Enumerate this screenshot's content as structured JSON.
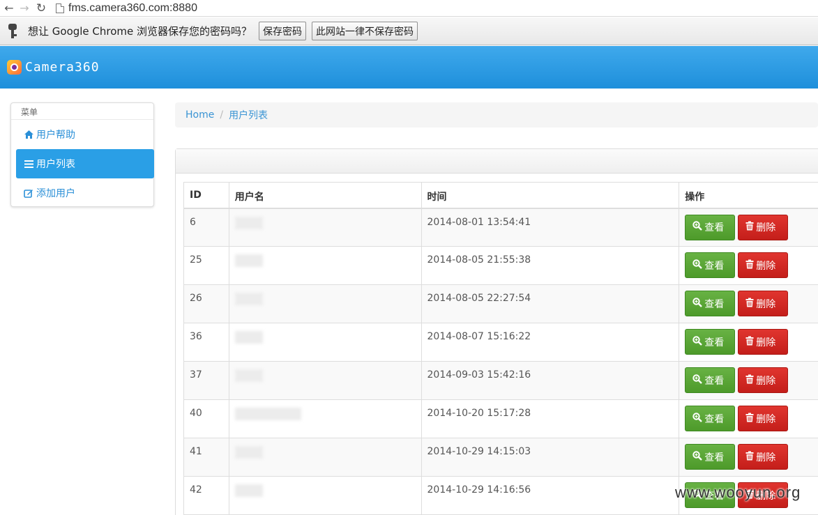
{
  "browser": {
    "url": "fms.camera360.com:8880",
    "back_icon": "arrow-left-icon",
    "forward_icon": "arrow-right-icon",
    "reload_icon": "reload-icon"
  },
  "infobar": {
    "message": "想让 Google Chrome 浏览器保存您的密码吗？",
    "save_label": "保存密码",
    "never_label": "此网站一律不保存密码"
  },
  "header": {
    "brand": "Camera360"
  },
  "sidebar": {
    "title": "菜单",
    "items": [
      {
        "label": "用户帮助",
        "icon": "home-icon"
      },
      {
        "label": "用户列表",
        "icon": "list-icon",
        "active": true
      },
      {
        "label": "添加用户",
        "icon": "edit-icon"
      }
    ]
  },
  "breadcrumb": {
    "home": "Home",
    "separator": "/",
    "current": "用户列表"
  },
  "table": {
    "headers": {
      "id": "ID",
      "username": "用户名",
      "time": "时间",
      "actions": "操作"
    },
    "view_label": "查看",
    "delete_label": "删除",
    "rows": [
      {
        "id": "6",
        "username": "",
        "time": "2014-08-01 13:54:41"
      },
      {
        "id": "25",
        "username": "",
        "time": "2014-08-05 21:55:38"
      },
      {
        "id": "26",
        "username": "",
        "time": "2014-08-05 22:27:54"
      },
      {
        "id": "36",
        "username": "",
        "time": "2014-08-07 15:16:22"
      },
      {
        "id": "37",
        "username": "",
        "time": "2014-09-03 15:42:16"
      },
      {
        "id": "40",
        "username": "",
        "time": "2014-10-20 15:17:28"
      },
      {
        "id": "41",
        "username": "",
        "time": "2014-10-29 14:15:03"
      },
      {
        "id": "42",
        "username": "",
        "time": "2014-10-29 14:16:56"
      }
    ]
  },
  "watermark": "www.wooyun.org",
  "colors": {
    "header_blue": "#2a9fe6",
    "view_green": "#5aa634",
    "delete_red": "#d32a25"
  }
}
